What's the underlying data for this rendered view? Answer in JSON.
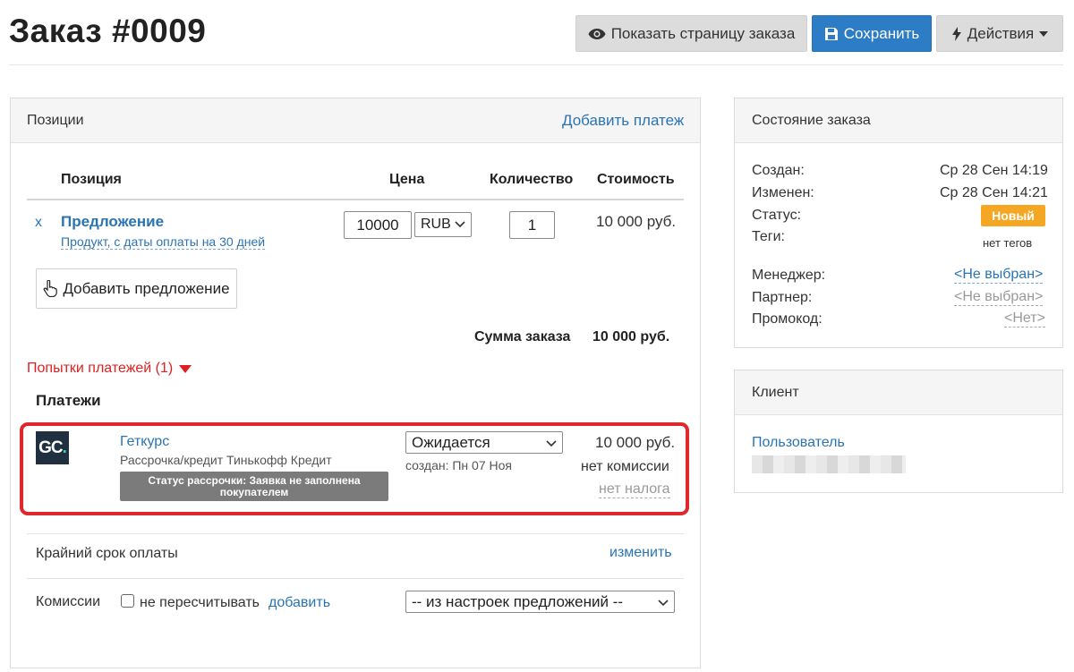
{
  "header": {
    "title": "Заказ #0009",
    "show_page_label": "Показать страницу заказа",
    "save_label": "Сохранить",
    "actions_label": "Действия"
  },
  "positions": {
    "panel_title": "Позиции",
    "add_payment_label": "Добавить платеж",
    "columns": {
      "item": "Позиция",
      "price": "Цена",
      "quantity": "Количество",
      "cost": "Стоимость"
    },
    "item": {
      "remove": "x",
      "name": "Предложение",
      "description": "Продукт, с даты оплаты на 30 дней",
      "price": "10000",
      "currency": "RUB",
      "quantity": "1",
      "cost": "10 000 руб."
    },
    "add_offer_label": "Добавить предложение",
    "total_label": "Сумма заказа",
    "total_value": "10 000 руб.",
    "payment_attempts_label": "Попытки платежей (1)",
    "payments_heading": "Платежи",
    "payment": {
      "logo_text": "GC",
      "logo_dot": ".",
      "provider": "Геткурс",
      "method": "Рассрочка/кредит Тинькофф Кредит",
      "installment_status": "Статус рассрочки: Заявка не заполнена покупателем",
      "status": "Ожидается",
      "created": "создан: Пн 07 Ноя",
      "amount": "10 000 руб.",
      "commission": "нет комиссии",
      "tax": "нет налога"
    },
    "deadline_label": "Крайний срок оплаты",
    "deadline_change": "изменить",
    "commissions_label": "Комиссии",
    "no_recalc_label": "не пересчитывать",
    "add_label": "добавить",
    "commission_select": "-- из настроек предложений --"
  },
  "order_state": {
    "panel_title": "Состояние заказа",
    "created_label": "Создан:",
    "created_value": "Ср 28 Сен 14:19",
    "modified_label": "Изменен:",
    "modified_value": "Ср 28 Сен 14:21",
    "status_label": "Статус:",
    "status_value": "Новый",
    "tags_label": "Теги:",
    "tags_value": "нет тегов",
    "manager_label": "Менеджер:",
    "manager_value": "<Не выбран>",
    "partner_label": "Партнер:",
    "partner_value": "<Не выбран>",
    "promo_label": "Промокод:",
    "promo_value": "<Нет>"
  },
  "client": {
    "panel_title": "Клиент",
    "user_label": "Пользователь"
  },
  "colors": {
    "accent": "#2d7cc6",
    "status_new": "#f5a623",
    "highlight": "#e0272b",
    "attempts": "#e02020"
  }
}
